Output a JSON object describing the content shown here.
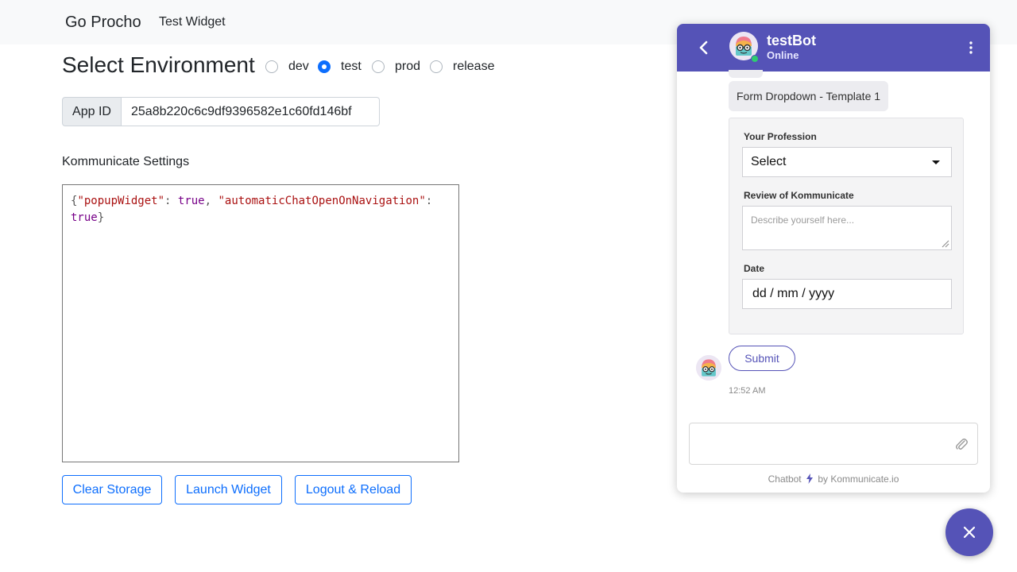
{
  "nav": {
    "brand": "Go Procho",
    "link": "Test Widget"
  },
  "environment": {
    "title": "Select Environment",
    "options": [
      {
        "label": "dev",
        "checked": false
      },
      {
        "label": "test",
        "checked": true
      },
      {
        "label": "prod",
        "checked": false
      },
      {
        "label": "release",
        "checked": false
      }
    ]
  },
  "app_id": {
    "label": "App ID",
    "value": "25a8b220c6c9df9396582e1c60fd146bf"
  },
  "settings": {
    "label": "Kommunicate Settings",
    "json_tokens": [
      "{",
      "\"popupWidget\"",
      ":",
      "true",
      ",",
      "\"automaticChatOpenOnNavigation\"",
      ":",
      "true",
      "}"
    ]
  },
  "buttons": {
    "clear": "Clear Storage",
    "launch": "Launch Widget",
    "logout": "Logout & Reload"
  },
  "widget": {
    "bot_name": "testBot",
    "status": "Online",
    "message": "Form Dropdown - Template 1",
    "form": {
      "profession_label": "Your Profession",
      "profession_value": "Select",
      "review_label": "Review of Kommunicate",
      "review_placeholder": "Describe yourself here...",
      "date_label": "Date",
      "date_placeholder": "dd / mm / yyyy"
    },
    "submit": "Submit",
    "time": "12:52 AM",
    "powered_prefix": "Chatbot",
    "powered_suffix": "by Kommunicate.io",
    "accent_color": "#5553b7"
  }
}
